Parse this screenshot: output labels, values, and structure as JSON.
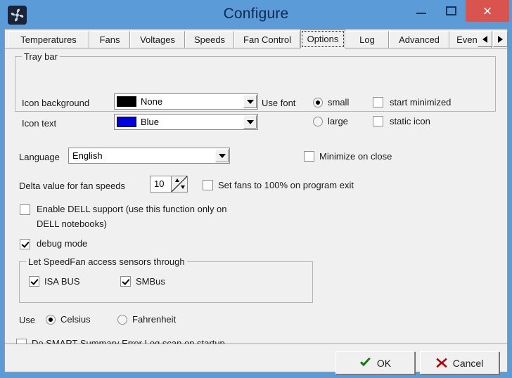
{
  "window": {
    "title": "Configure",
    "app_icon": "fan-icon",
    "controls": {
      "minimize": "minimize-icon",
      "maximize": "maximize-icon",
      "close": "close-icon"
    },
    "title_color": "#0e2a50",
    "frame_color": "#5b9bd8",
    "close_color": "#d9534f"
  },
  "tabs": {
    "items": [
      {
        "label": "Temperatures",
        "selected": false
      },
      {
        "label": "Fans",
        "selected": false
      },
      {
        "label": "Voltages",
        "selected": false
      },
      {
        "label": "Speeds",
        "selected": false
      },
      {
        "label": "Fan Control",
        "selected": false
      },
      {
        "label": "Options",
        "selected": true
      },
      {
        "label": "Log",
        "selected": false
      },
      {
        "label": "Advanced",
        "selected": false
      },
      {
        "label": "Events",
        "selected": false
      }
    ],
    "scroll_left": "scroll-left-arrow",
    "scroll_right": "scroll-right-arrow"
  },
  "tray_bar": {
    "group_title": "Tray bar",
    "icon_background_label": "Icon background",
    "icon_background_value": "None",
    "icon_background_swatch": "#000000",
    "icon_text_label": "Icon text",
    "icon_text_value": "Blue",
    "icon_text_swatch": "#0000e0",
    "use_font_label": "Use font",
    "font_small": "small",
    "font_large": "large",
    "font_selected": "small",
    "start_minimized": "start minimized",
    "start_minimized_checked": false,
    "static_icon": "static icon",
    "static_icon_checked": false
  },
  "language": {
    "label": "Language",
    "value": "English"
  },
  "delta": {
    "label": "Delta value for fan speeds",
    "value": "10"
  },
  "options": {
    "minimize_on_close": "Minimize on close",
    "minimize_on_close_checked": false,
    "set_fans_100": "Set fans to 100% on program exit",
    "set_fans_100_checked": false,
    "enable_dell_line1": "Enable DELL support (use this function only on",
    "enable_dell_line2": "DELL notebooks)",
    "enable_dell_checked": false,
    "debug_mode": "debug mode",
    "debug_mode_checked": true,
    "do_smart_scan": "Do SMART Summary Error Log scan on startup",
    "do_smart_scan_checked": false
  },
  "sensors": {
    "group_title": "Let SpeedFan access sensors through",
    "isa_bus": "ISA BUS",
    "isa_bus_checked": true,
    "smbus": "SMBus",
    "smbus_checked": true
  },
  "units": {
    "label": "Use",
    "celsius": "Celsius",
    "fahrenheit": "Fahrenheit",
    "selected": "Celsius"
  },
  "buttons": {
    "ok": "OK",
    "ok_icon": "check-icon",
    "ok_icon_color": "#0a8a0a",
    "cancel": "Cancel",
    "cancel_icon": "x-icon",
    "cancel_icon_color": "#b00000"
  }
}
